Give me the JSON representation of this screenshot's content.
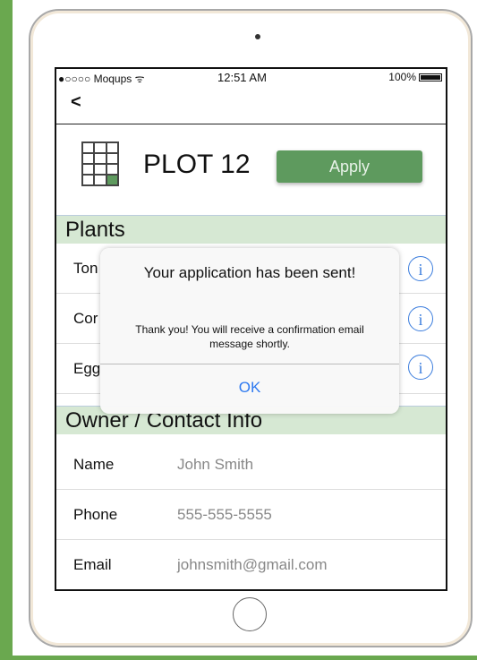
{
  "status_bar": {
    "carrier": "●○○○○ Moqups ᯤ",
    "time": "12:51 AM",
    "battery": "100%"
  },
  "nav": {
    "back": "<"
  },
  "header": {
    "plot_title": "PLOT 12",
    "apply_label": "Apply"
  },
  "plants": {
    "section_title": "Plants",
    "items": [
      {
        "label": "Ton"
      },
      {
        "label": "Cor"
      },
      {
        "label": "Egg"
      }
    ],
    "info_glyph": "i"
  },
  "owner": {
    "section_title": "Owner / Contact Info",
    "rows": [
      {
        "label": "Name",
        "value": "John Smith"
      },
      {
        "label": "Phone",
        "value": "555-555-5555"
      },
      {
        "label": "Email",
        "value": "johnsmith@gmail.com"
      }
    ]
  },
  "alert": {
    "title": "Your application has been sent!",
    "message": "Thank you! You will receive a confirmation email message shortly.",
    "ok_label": "OK"
  },
  "colors": {
    "accent_green": "#5e9a5e",
    "section_bg": "#d6e8d3",
    "frame_green": "#6aa84f",
    "link_blue": "#2f7af0"
  }
}
